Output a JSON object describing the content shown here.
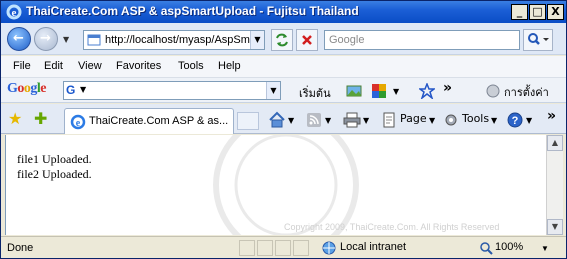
{
  "window": {
    "title": "ThaiCreate.Com ASP & aspSmartUpload - Fujitsu Thailand",
    "min_label": "_",
    "max_label": "□",
    "close_label": "X"
  },
  "address_bar": {
    "url": "http://localhost/myasp/AspSm",
    "search_placeholder": "Google"
  },
  "menu": [
    "File",
    "Edit",
    "View",
    "Favorites",
    "Tools",
    "Help"
  ],
  "google_toolbar": {
    "logo": "Google",
    "search_button": "เริ่มต้น",
    "more": "»",
    "settings": "การตั้งค่า"
  },
  "command_bar": {
    "tab_title": "ThaiCreate.Com ASP & as...",
    "page_label": "Page",
    "tools_label": "Tools",
    "more": "»"
  },
  "content": {
    "lines": [
      "file1 Uploaded.",
      "file2 Uploaded."
    ],
    "watermark": "Copyright 2009, ThaiCreate.Com. All Rights Reserved"
  },
  "status_bar": {
    "status": "Done",
    "zone": "Local intranet",
    "zoom": "100%"
  },
  "colors": {
    "title_bar": "#1b5fd6",
    "chrome": "#dfe8f6",
    "status_bar": "#ece9d8"
  }
}
